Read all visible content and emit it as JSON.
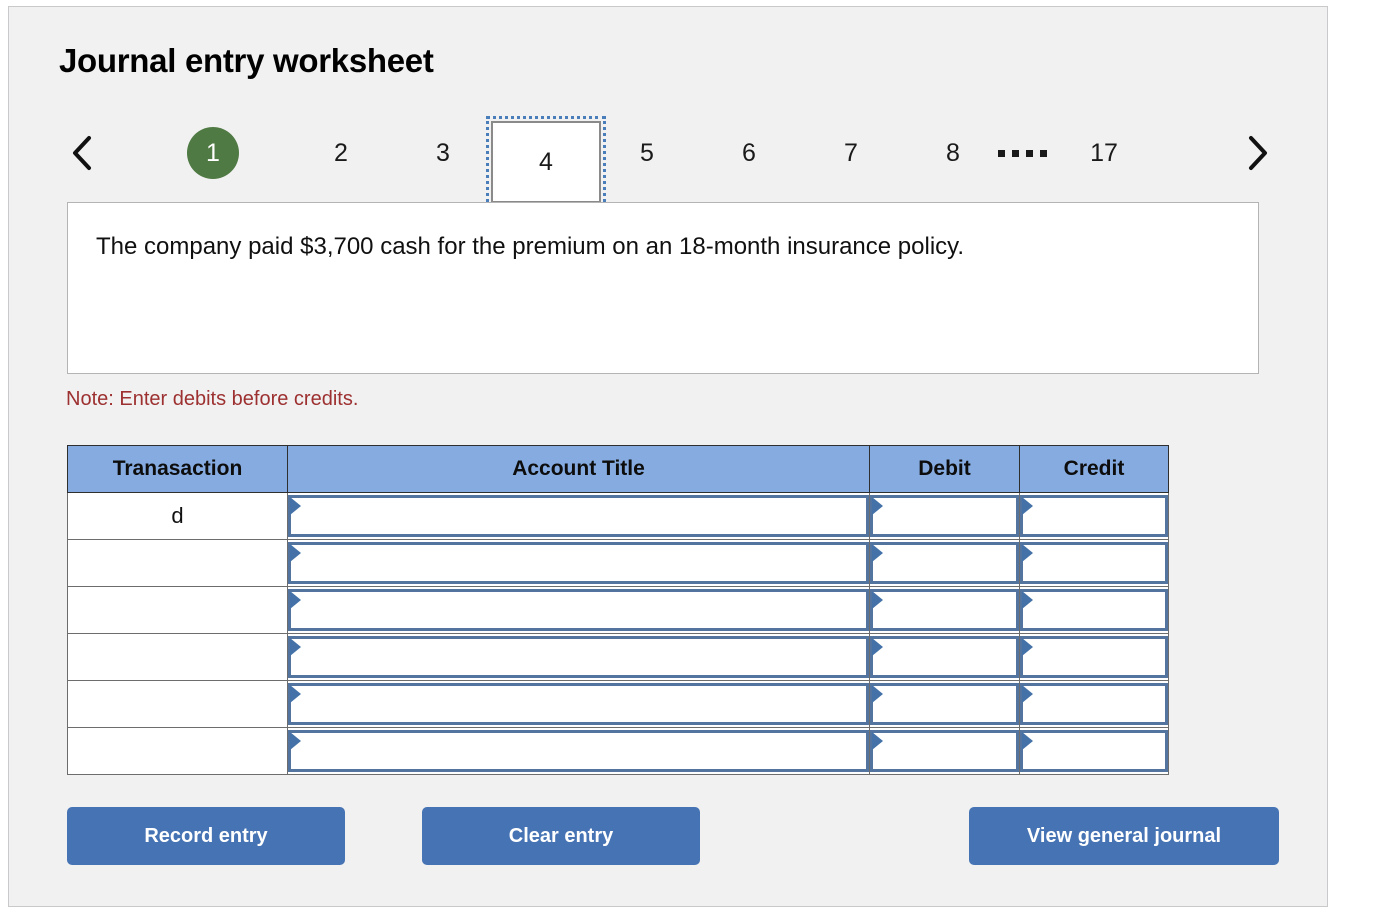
{
  "page": {
    "title": "Journal entry worksheet"
  },
  "pager": {
    "prev_icon": "chevron-left-icon",
    "next_icon": "chevron-right-icon",
    "ellipsis": ".....",
    "items": [
      {
        "label": "1",
        "state": "completed"
      },
      {
        "label": "2",
        "state": "normal"
      },
      {
        "label": "3",
        "state": "normal"
      },
      {
        "label": "4",
        "state": "selected"
      },
      {
        "label": "5",
        "state": "normal"
      },
      {
        "label": "6",
        "state": "normal"
      },
      {
        "label": "7",
        "state": "normal"
      },
      {
        "label": "8",
        "state": "normal"
      },
      {
        "label": "17",
        "state": "normal"
      }
    ]
  },
  "prompt": {
    "text": "The company paid $3,700 cash for the premium on an 18-month insurance policy."
  },
  "note": {
    "text": "Note: Enter debits before credits."
  },
  "table": {
    "headers": {
      "transaction": "Tranasaction",
      "account_title": "Account Title",
      "debit": "Debit",
      "credit": "Credit"
    },
    "rows": [
      {
        "transaction": "d",
        "account_title": "",
        "debit": "",
        "credit": ""
      },
      {
        "transaction": "",
        "account_title": "",
        "debit": "",
        "credit": ""
      },
      {
        "transaction": "",
        "account_title": "",
        "debit": "",
        "credit": ""
      },
      {
        "transaction": "",
        "account_title": "",
        "debit": "",
        "credit": ""
      },
      {
        "transaction": "",
        "account_title": "",
        "debit": "",
        "credit": ""
      },
      {
        "transaction": "",
        "account_title": "",
        "debit": "",
        "credit": ""
      }
    ],
    "input_placeholder": ""
  },
  "buttons": {
    "record": "Record entry",
    "clear": "Clear entry",
    "view": "View general journal"
  },
  "colors": {
    "panel_bg": "#f1f1f1",
    "header_blue": "#85abe0",
    "button_blue": "#4573b4",
    "badge_green": "#4f7a43",
    "note_red": "#9d3030",
    "input_border": "#53749f"
  }
}
